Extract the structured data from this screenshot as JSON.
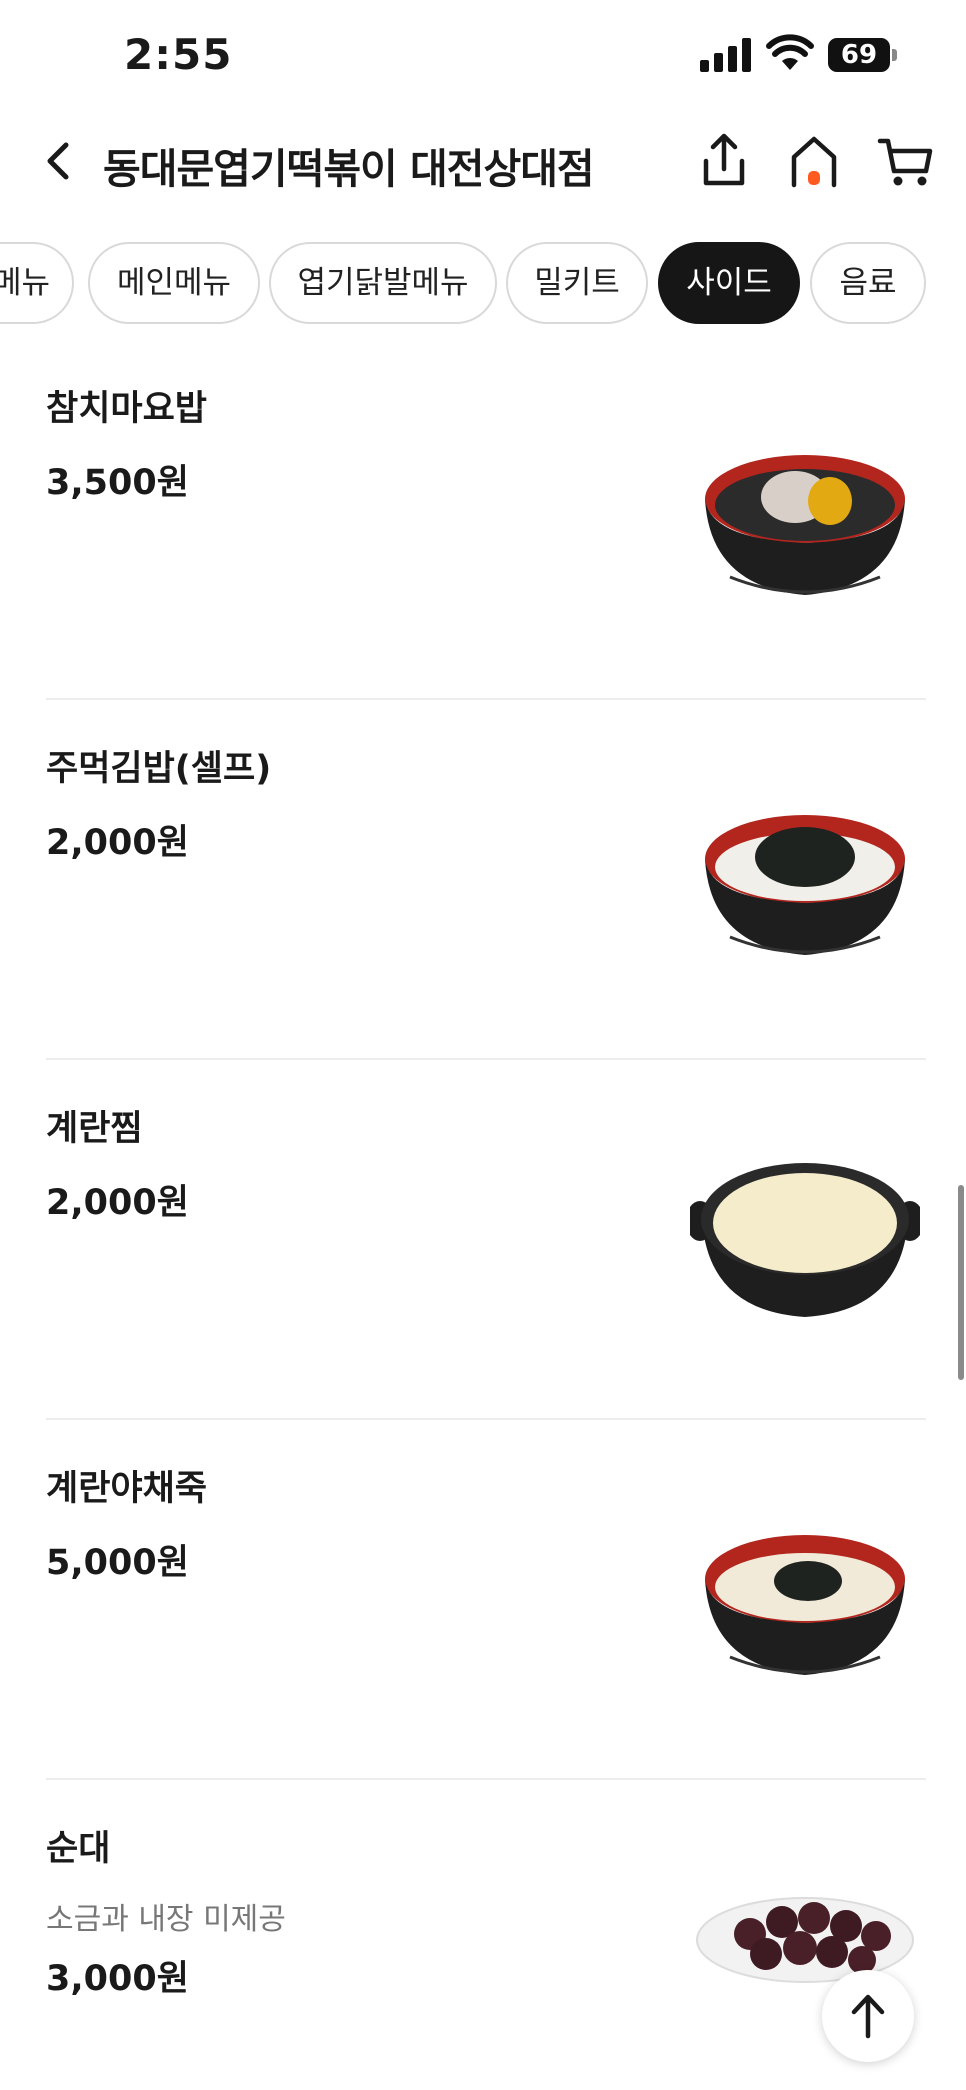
{
  "status_bar": {
    "time": "2:55",
    "battery": "69"
  },
  "header": {
    "title": "동대문엽기떡볶이 대전상대점",
    "icons": [
      "chevron-left-icon",
      "share-icon",
      "home-icon",
      "cart-icon"
    ],
    "accent_color": "#ff5a1f"
  },
  "tabs": [
    {
      "label": "메뉴",
      "active": false
    },
    {
      "label": "메인메뉴",
      "active": false
    },
    {
      "label": "엽기닭발메뉴",
      "active": false
    },
    {
      "label": "밀키트",
      "active": false
    },
    {
      "label": "사이드",
      "active": true
    },
    {
      "label": "음료",
      "active": false
    }
  ],
  "menu": [
    {
      "name": "참치마요밥",
      "price": "3,500원",
      "image": "tuna-mayo-rice-bowl"
    },
    {
      "name": "주먹김밥(셀프)",
      "price": "2,000원",
      "image": "seaweed-rice-bowl"
    },
    {
      "name": "계란찜",
      "price": "2,000원",
      "image": "steamed-egg-pot"
    },
    {
      "name": "계란야채죽",
      "price": "5,000원",
      "image": "egg-vegetable-porridge-bowl"
    },
    {
      "name": "순대",
      "description": "소금과 내장 미제공",
      "price": "3,000원",
      "image": "sundae-plate"
    }
  ]
}
